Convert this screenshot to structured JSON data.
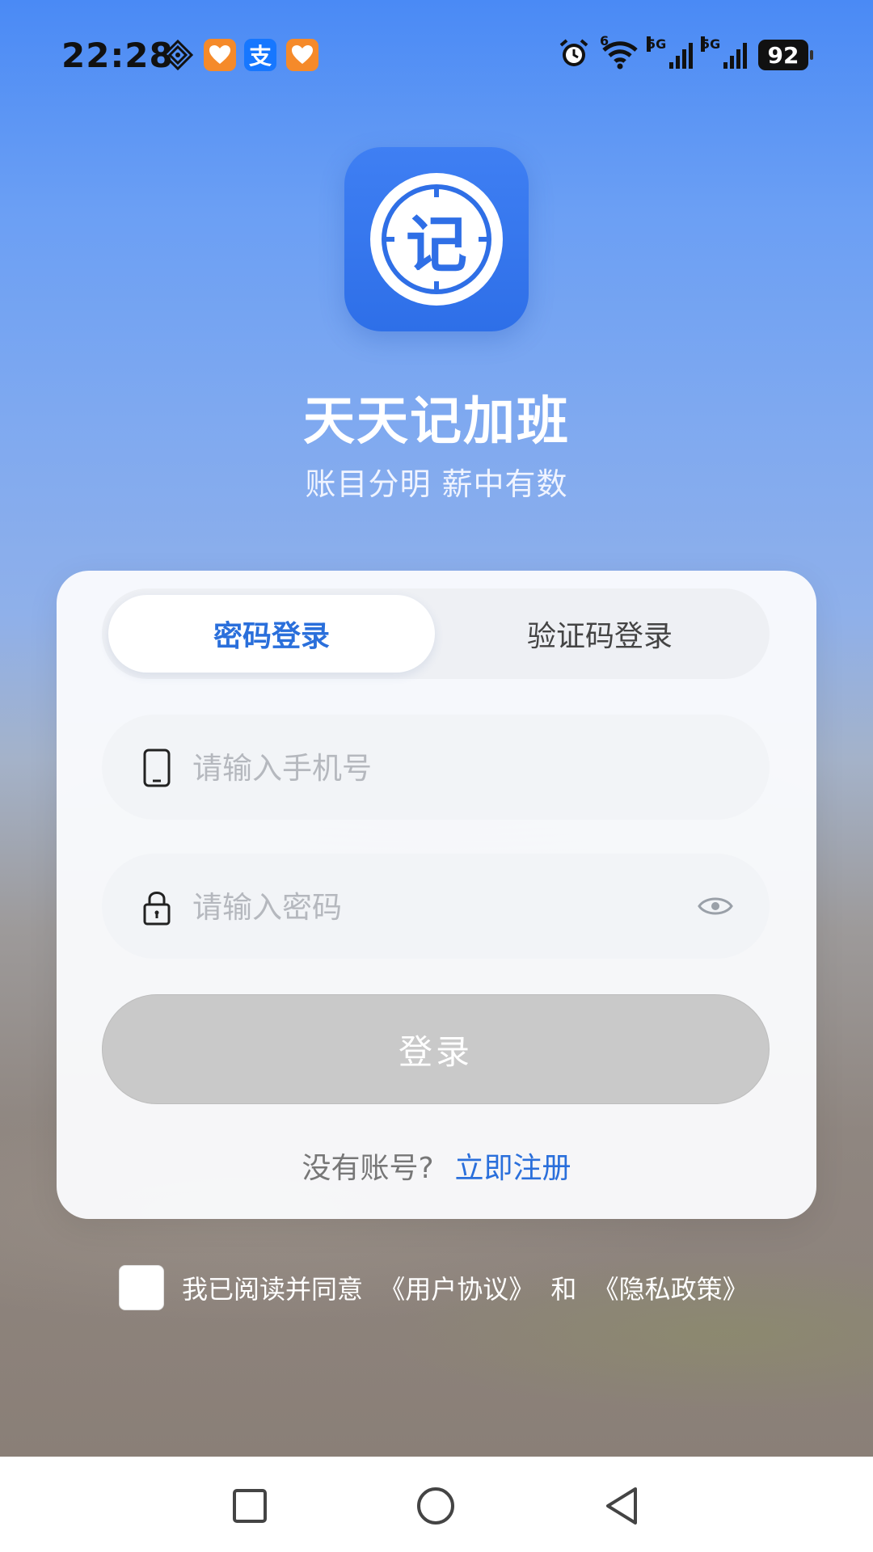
{
  "status_bar": {
    "time": "22:28",
    "network_label_1": "5G",
    "network_label_2": "5G",
    "wifi_label": "6",
    "battery": "92",
    "pay_label": "支"
  },
  "app": {
    "icon_char": "记",
    "title": "天天记加班",
    "subtitle": "账目分明 薪中有数",
    "brand_color": "#3a7bf0"
  },
  "tabs": {
    "password_login": "密码登录",
    "code_login": "验证码登录"
  },
  "form": {
    "phone_placeholder": "请输入手机号",
    "password_placeholder": "请输入密码",
    "login_button": "登录",
    "no_account": "没有账号?",
    "register_link": "立即注册"
  },
  "agreement": {
    "prefix": "我已阅读并同意",
    "user_agreement": "《用户协议》",
    "and": "和",
    "privacy_policy": "《隐私政策》"
  },
  "nav": {
    "recent_icon": "square-icon",
    "home_icon": "circle-icon",
    "back_icon": "triangle-back-icon"
  }
}
